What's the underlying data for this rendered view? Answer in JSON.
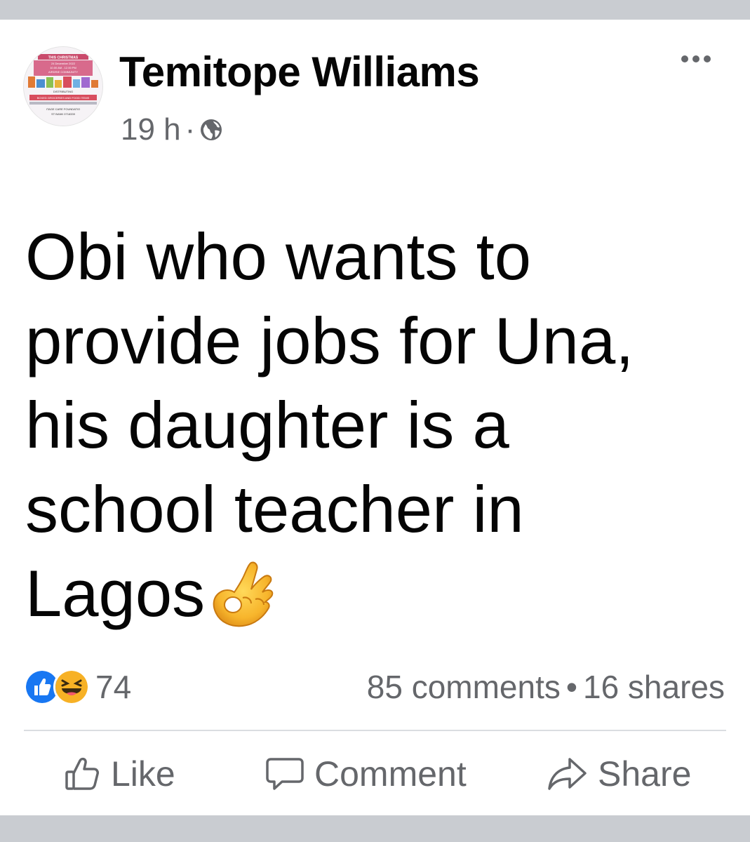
{
  "post": {
    "author": "Temitope Williams",
    "time": "19 h",
    "separator": "·",
    "privacy_icon": "globe-icon",
    "text_lines": [
      "Obi who wants to",
      "provide jobs for Una,",
      "his daughter is a",
      "school teacher in",
      "Lagos"
    ],
    "emoji": "ok-hand-emoji",
    "avatar_text_lines": [
      "THIS CHRISTMAS",
      "24 December 2022",
      "10.00 AM - 12.00 PM",
      "AIRDRIE COMMUNITY",
      "DISTRIBUTING",
      "BOXED GROCERIES AND FOOD ITEMS",
      "ITAGE CARE FOUNDATIO",
      "ST BANK 0716339"
    ]
  },
  "stats": {
    "reaction_icons": [
      "like-icon",
      "haha-icon"
    ],
    "reaction_count": "74",
    "comments": "85 comments",
    "dot": "•",
    "shares": "16 shares"
  },
  "actions": {
    "like": "Like",
    "comment": "Comment",
    "share": "Share"
  },
  "colors": {
    "background": "#c9ccd1",
    "card": "#ffffff",
    "text_primary": "#050505",
    "text_secondary": "#65676b",
    "like_blue": "#1877f2",
    "haha_yellow": "#f7b125"
  }
}
